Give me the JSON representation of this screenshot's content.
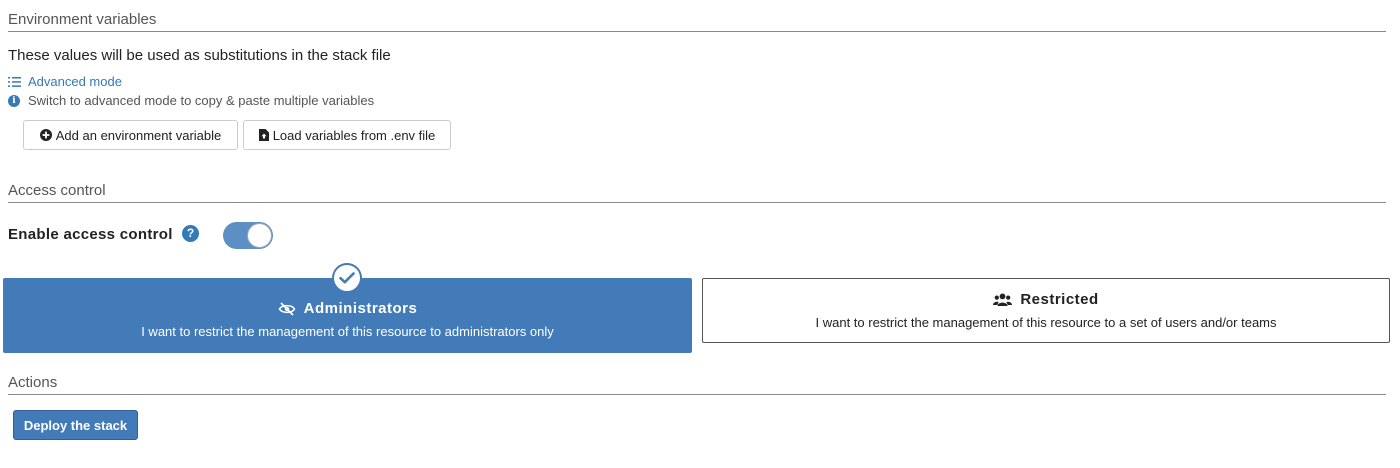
{
  "env_section": {
    "title": "Environment variables",
    "description": "These values will be used as substitutions in the stack file",
    "advanced_mode_label": "Advanced mode",
    "hint": "Switch to advanced mode to copy & paste multiple variables",
    "add_button_label": "Add an environment variable",
    "load_button_label": "Load variables from .env file"
  },
  "access_section": {
    "title": "Access control",
    "toggle_label": "Enable access control",
    "toggle_on": true,
    "options": [
      {
        "title": "Administrators",
        "description": "I want to restrict the management of this resource to administrators only",
        "icon": "eye-slash-icon",
        "selected": true
      },
      {
        "title": "Restricted",
        "description": "I want to restrict the management of this resource to a set of users and/or teams",
        "icon": "users-icon",
        "selected": false
      }
    ]
  },
  "actions_section": {
    "title": "Actions",
    "deploy_button_label": "Deploy the stack"
  },
  "colors": {
    "primary": "#427bb8",
    "link": "#337ab7",
    "toggle_track": "#5e8fc4"
  }
}
